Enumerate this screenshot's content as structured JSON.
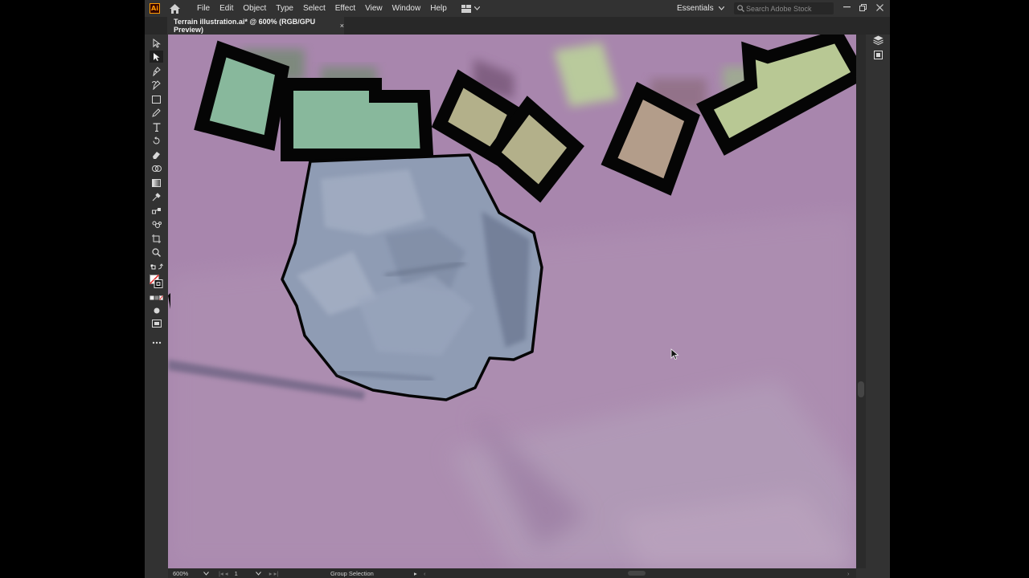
{
  "app": {
    "logo_text": "Ai"
  },
  "menubar": {
    "items": [
      "File",
      "Edit",
      "Object",
      "Type",
      "Select",
      "Effect",
      "View",
      "Window",
      "Help"
    ],
    "workspace": "Essentials",
    "search_placeholder": "Search Adobe Stock"
  },
  "document": {
    "tab_title": "Terrain illustration.ai* @ 600% (RGB/GPU Preview)",
    "close_glyph": "×"
  },
  "statusbar": {
    "zoom": "600%",
    "artboard": "1",
    "status": "Group Selection"
  },
  "toolbar": {
    "tools": [
      "selection-icon",
      "direct-selection-icon",
      "pen-icon",
      "curvature-icon",
      "rectangle-icon",
      "pencil-icon",
      "type-icon",
      "rotate-icon",
      "eraser-icon",
      "shape-builder-icon",
      "gradient-icon",
      "eyedropper-icon",
      "blend-icon",
      "symbol-sprayer-icon",
      "artboard-icon",
      "zoom-icon"
    ]
  },
  "colors": {
    "canvas_bg": "#a886ad",
    "rock_fill": "#8f9cb4",
    "tile_green": "#88b89c",
    "tile_khaki": "#b3b08a",
    "tile_tan": "#b39d8a",
    "tile_lime": "#b8c894",
    "ui_panel": "#323232"
  }
}
